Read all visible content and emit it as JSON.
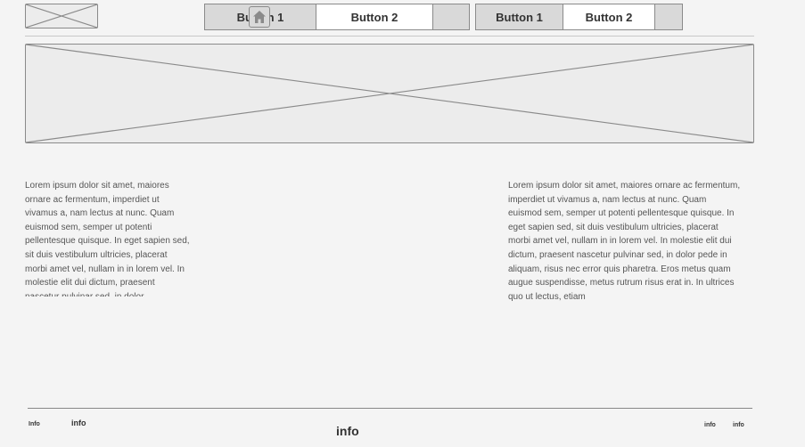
{
  "header": {
    "logo_icon": "image-placeholder-icon",
    "nav_group_1": {
      "button_1": "Button 1",
      "button_2": "Button 2"
    },
    "nav_group_2": {
      "button_1": "Button 1",
      "button_2": "Button 2"
    },
    "home_icon": "home-icon"
  },
  "hero": {
    "icon": "image-placeholder-icon"
  },
  "content": {
    "left_text": "Lorem ipsum dolor sit amet, maiores ornare ac fermentum, imperdiet ut vivamus a, nam lectus at nunc. Quam euismod sem, semper ut potenti pellentesque quisque. In eget sapien sed, sit duis vestibulum ultricies, placerat morbi amet vel, nullam in in lorem vel. In molestie elit dui dictum, praesent nascetur pulvinar sed, in dolor",
    "right_text": "Lorem ipsum dolor sit amet, maiores ornare ac fermentum, imperdiet ut vivamus a, nam lectus at nunc. Quam euismod sem, semper ut potenti pellentesque quisque. In eget sapien sed, sit duis vestibulum ultricies, placerat morbi amet vel, nullam in in lorem vel. In molestie elit dui dictum, praesent nascetur pulvinar sed, in dolor pede in aliquam, risus nec error quis pharetra. Eros metus quam augue suspendisse, metus rutrum risus erat in.  In ultrices quo ut lectus, etiam"
  },
  "footer": {
    "info_1": "Info",
    "info_2": "info",
    "info_center": "info",
    "info_right_1": "info",
    "info_right_2": "info"
  }
}
